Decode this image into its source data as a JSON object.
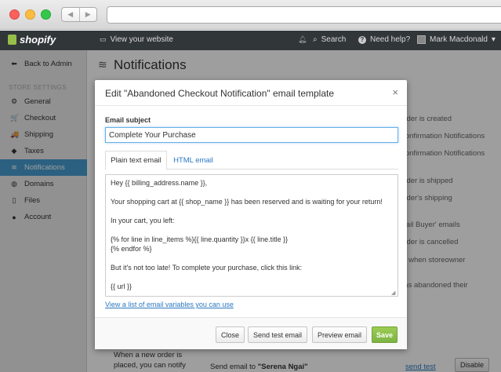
{
  "browser": {
    "back_icon": "chevron-left-icon",
    "forward_icon": "chevron-right-icon"
  },
  "topbar": {
    "logo": "shopify",
    "view_website": "View your website",
    "search": "Search",
    "help": "Need help?",
    "user": "Mark Macdonald",
    "user_caret": "▾"
  },
  "sidebar": {
    "back": "Back to Admin",
    "section": "STORE SETTINGS",
    "items": [
      {
        "label": "General",
        "icon": "gear-icon",
        "glyph": "⚙"
      },
      {
        "label": "Checkout",
        "icon": "cart-icon",
        "glyph": "🛒"
      },
      {
        "label": "Shipping",
        "icon": "truck-icon",
        "glyph": "🚚"
      },
      {
        "label": "Taxes",
        "icon": "tag-icon",
        "glyph": "◆"
      },
      {
        "label": "Notifications",
        "icon": "wifi-icon",
        "glyph": "≋"
      },
      {
        "label": "Domains",
        "icon": "globe-icon",
        "glyph": "◍"
      },
      {
        "label": "Files",
        "icon": "file-icon",
        "glyph": "▯"
      },
      {
        "label": "Account",
        "icon": "user-icon",
        "glyph": "●"
      }
    ]
  },
  "main": {
    "title": "Notifications",
    "bg_rows": [
      "order is created",
      "Confirmation Notifications",
      "Confirmation Notifications",
      "order is shipped",
      "order's shipping",
      "mail Buyer' emails",
      "order is cancelled",
      "er when storeowner",
      "has abandoned their"
    ],
    "bottom_left1": "When a new order is",
    "bottom_left2": "placed, you can notify",
    "send_email_prefix": "Send email to ",
    "send_email_name": "\"Serena Ngai\"",
    "send_test": "send test",
    "disable": "Disable"
  },
  "modal": {
    "title": "Edit \"Abandoned Checkout Notification\" email template",
    "close_glyph": "×",
    "subject_label": "Email subject",
    "subject_value": "Complete Your Purchase",
    "tab_plain": "Plain text email",
    "tab_html": "HTML email",
    "body_lines": [
      "Hey {{ billing_address.name }},",
      "",
      "Your shopping cart at {{ shop_name }} has been reserved and is waiting for your return!",
      "",
      "In your cart, you left:",
      "",
      "{% for line in line_items %}{{ line.quantity }}x {{ line.title }}",
      "{% endfor %}",
      "",
      "But it's not too late! To complete your purchase, click this link:",
      "",
      "{{ url }}"
    ],
    "variables_link": "View a list of email variables you can use",
    "buttons": {
      "close": "Close",
      "send_test": "Send test email",
      "preview": "Preview email",
      "save": "Save"
    }
  },
  "colors": {
    "accent": "#479ccf",
    "save": "#7cb342",
    "topbar": "#313639"
  }
}
